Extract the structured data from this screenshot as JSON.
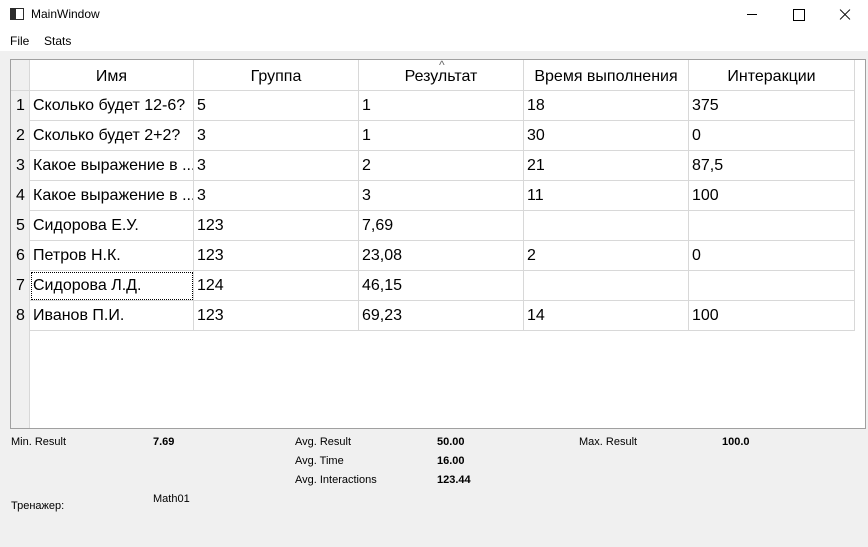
{
  "window": {
    "title": "MainWindow"
  },
  "menu": {
    "file": "File",
    "stats": "Stats"
  },
  "table": {
    "headers": [
      "Имя",
      "Группа",
      "Результат",
      "Время выполнения",
      "Интеракции"
    ],
    "sort_indicator": "^",
    "rows": [
      {
        "num": "1",
        "cells": [
          "Сколько будет 12-6?",
          "5",
          "1",
          "18",
          "375"
        ]
      },
      {
        "num": "2",
        "cells": [
          "Сколько будет 2+2?",
          "3",
          "1",
          "30",
          "0"
        ]
      },
      {
        "num": "3",
        "cells": [
          "Какое выражение в ...",
          "3",
          "2",
          "21",
          "87,5"
        ]
      },
      {
        "num": "4",
        "cells": [
          "Какое выражение в ...",
          "3",
          "3",
          "11",
          "100"
        ]
      },
      {
        "num": "5",
        "cells": [
          "Сидорова Е.У.",
          "123",
          "7,69",
          "",
          ""
        ]
      },
      {
        "num": "6",
        "cells": [
          "Петров Н.К.",
          "123",
          "23,08",
          "2",
          "0"
        ]
      },
      {
        "num": "7",
        "cells": [
          "Сидорова Л.Д.",
          "124",
          "46,15",
          "",
          ""
        ]
      },
      {
        "num": "8",
        "cells": [
          "Иванов П.И.",
          "123",
          "69,23",
          "14",
          "100"
        ]
      }
    ]
  },
  "stats": {
    "min_result_label": "Min. Result",
    "min_result_value": "7.69",
    "avg_result_label": "Avg. Result",
    "avg_result_value": "50.00",
    "max_result_label": "Max. Result",
    "max_result_value": "100.0",
    "avg_time_label": "Avg. Time",
    "avg_time_value": "16.00",
    "avg_interactions_label": "Avg. Interactions",
    "avg_interactions_value": "123.44",
    "trainer_label": "Тренажер:",
    "trainer_value": "Math01"
  }
}
